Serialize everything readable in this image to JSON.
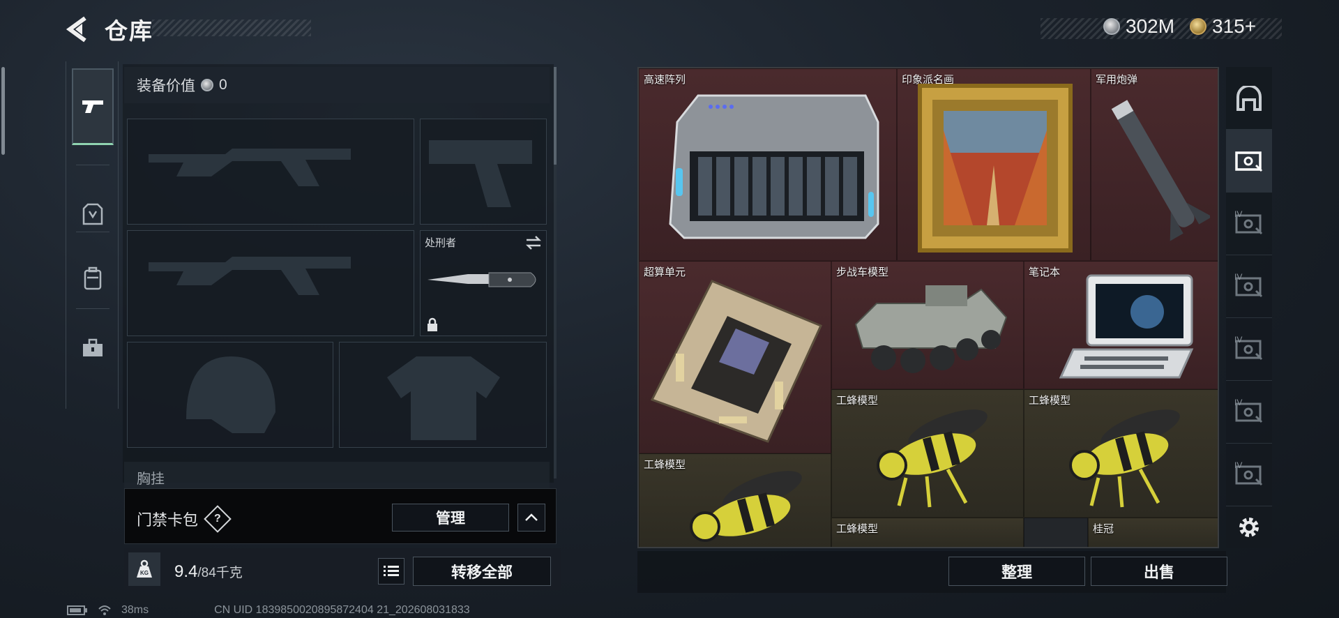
{
  "header": {
    "title": "仓库",
    "silver_amount": "302M",
    "gold_amount": "315+"
  },
  "equipment": {
    "value_label": "装备价值",
    "value": "0",
    "melee_label": "处刑者",
    "chest_label": "胸挂"
  },
  "card_pack": {
    "label": "门禁卡包",
    "help": "?",
    "manage_label": "管理"
  },
  "weight": {
    "current": "9.4",
    "max": "/84千克",
    "icon_label": "KG"
  },
  "transfer_all_label": "转移全部",
  "items": [
    {
      "name": "高速阵列"
    },
    {
      "name": "印象派名画"
    },
    {
      "name": "军用炮弹"
    },
    {
      "name": "超算单元"
    },
    {
      "name": "步战车模型"
    },
    {
      "name": "笔记本"
    },
    {
      "name": "工蜂模型"
    },
    {
      "name": "工蜂模型"
    },
    {
      "name": "工蜂模型"
    },
    {
      "name": "工蜂模型"
    },
    {
      "name": "桂冠"
    }
  ],
  "actions": {
    "sort_label": "整理",
    "sell_label": "出售"
  },
  "right_tabs": [
    {
      "label": "IV"
    },
    {
      "label": "IV"
    },
    {
      "label": "IV"
    },
    {
      "label": "IV"
    },
    {
      "label": "IV"
    }
  ],
  "status": {
    "ping": "38ms",
    "uid": "CN UID 1839850020895872404 21_202608031833"
  },
  "colors": {
    "red_cell": "#4a2a2d",
    "gold_cell": "#3a3629",
    "active_tab_accent": "#8fd3b0"
  }
}
